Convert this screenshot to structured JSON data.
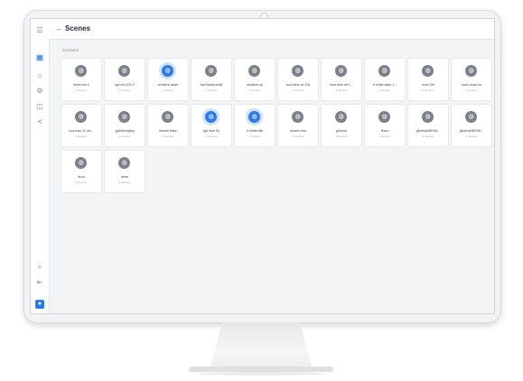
{
  "header": {
    "back_icon": "arrow-left-icon",
    "title": "Scenes"
  },
  "section_label": "SCENES",
  "rail": {
    "icons": [
      "menu-icon",
      "scenes-icon",
      "devices-icon",
      "automation-icon",
      "sensor-icon",
      "share-icon",
      "search-icon",
      "logout-icon",
      "user-icon"
    ],
    "active": "scenes-icon"
  },
  "scenes": [
    {
      "name": "dines eni 4",
      "devices": "1 devices",
      "active": false
    },
    {
      "name": "rgb red 100 1",
      "devices": "1 devices",
      "active": false
    },
    {
      "name": "shutters down",
      "devices": "1 devices",
      "active": true
    },
    {
      "name": "hca hubby heat",
      "devices": "2 devices",
      "active": false
    },
    {
      "name": "shutters up",
      "devices": "1 devices",
      "active": false
    },
    {
      "name": "boot time on 10s",
      "devices": "1 devices",
      "active": false
    },
    {
      "name": "boot time off 1...",
      "devices": "1 devices",
      "active": false
    },
    {
      "name": "rf white dsds 1...",
      "devices": "1 devices",
      "active": false
    },
    {
      "name": "boot ON",
      "devices": "3 devices",
      "active": false
    },
    {
      "name": "boot cloud on",
      "devices": "3 devices",
      "active": false
    },
    {
      "name": "hca ruks 22 zel...",
      "devices": "3 devices",
      "active": false
    },
    {
      "name": "gdbdhhhfgbg",
      "devices": "1 devices",
      "active": false
    },
    {
      "name": "bluarm false",
      "devices": "1 devices",
      "active": false
    },
    {
      "name": "rgb blue 50",
      "devices": "1 devices",
      "active": true
    },
    {
      "name": "rf white blis",
      "devices": "1 devices",
      "active": true
    },
    {
      "name": "bluarm true",
      "devices": "1 devices",
      "active": false
    },
    {
      "name": "g5cena",
      "devices": "1 devices",
      "active": false
    },
    {
      "name": "fircco",
      "devices": "1 devices",
      "active": false
    },
    {
      "name": "g5cena058765...",
      "devices": "1 devices",
      "active": false
    },
    {
      "name": "g5cena058765...",
      "devices": "1 devices",
      "active": false
    },
    {
      "name": "dvcd",
      "devices": "1 devices",
      "active": false
    },
    {
      "name": "dmm",
      "devices": "1 devices",
      "active": false
    }
  ],
  "colors": {
    "accent": "#2c7be5",
    "icon_idle": "#7b8089",
    "screen_bg": "#f3f4f6"
  }
}
